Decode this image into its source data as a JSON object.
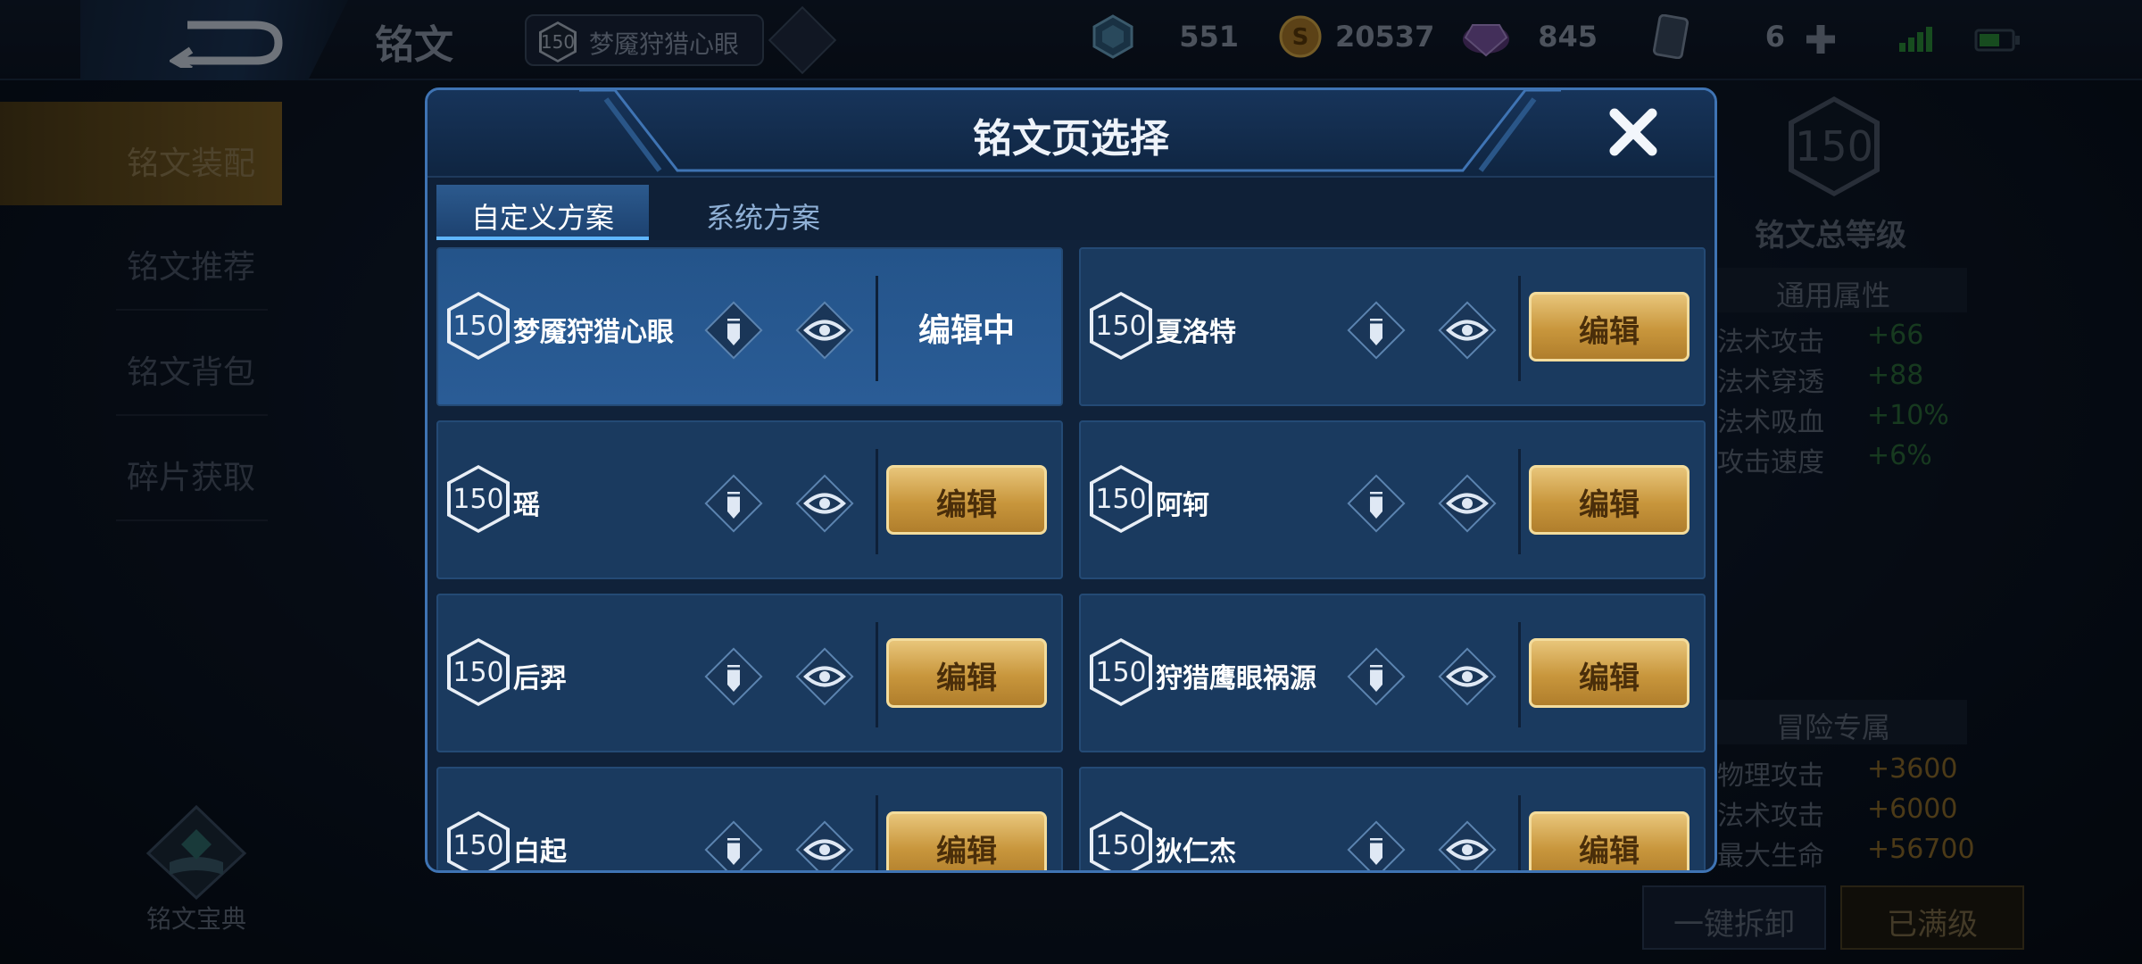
{
  "topbar": {
    "title": "铭文",
    "set_chip": {
      "level": "150",
      "name": "梦魇狩猎心眼"
    },
    "resources": [
      {
        "icon": "crystal-icon",
        "value": "551"
      },
      {
        "icon": "gold-coin-icon",
        "value": "20537"
      },
      {
        "icon": "gem-icon",
        "value": "845"
      },
      {
        "icon": "card-icon",
        "value": "6"
      }
    ]
  },
  "sidebar": {
    "items": [
      {
        "label": "铭文装配",
        "active": true
      },
      {
        "label": "铭文推荐"
      },
      {
        "label": "铭文背包"
      },
      {
        "label": "碎片获取"
      }
    ],
    "codex_label": "铭文宝典"
  },
  "right_panel": {
    "total_level": "150",
    "total_level_label": "铭文总等级",
    "general_header": "通用属性",
    "general_stats": [
      {
        "name": "法术攻击",
        "value": "+66"
      },
      {
        "name": "法术穿透",
        "value": "+88"
      },
      {
        "name": "法术吸血",
        "value": "+10%"
      },
      {
        "name": "攻击速度",
        "value": "+6%"
      }
    ],
    "adventure_header": "冒险专属",
    "adventure_stats": [
      {
        "name": "物理攻击",
        "value": "+3600"
      },
      {
        "name": "法术攻击",
        "value": "+6000"
      },
      {
        "name": "最大生命",
        "value": "+56700"
      }
    ],
    "btn_disassemble": "一键拆卸",
    "btn_maxed": "已满级"
  },
  "dialog": {
    "title": "铭文页选择",
    "tabs": [
      {
        "label": "自定义方案",
        "active": true
      },
      {
        "label": "系统方案"
      }
    ],
    "edit_label": "编辑",
    "editing_label": "编辑中",
    "pages": [
      {
        "level": "150",
        "name": "梦魇狩猎心眼",
        "editing": true
      },
      {
        "level": "150",
        "name": "夏洛特"
      },
      {
        "level": "150",
        "name": "瑶"
      },
      {
        "level": "150",
        "name": "阿轲"
      },
      {
        "level": "150",
        "name": "后羿"
      },
      {
        "level": "150",
        "name": "狩猎鹰眼祸源"
      },
      {
        "level": "150",
        "name": "白起"
      },
      {
        "level": "150",
        "name": "狄仁杰"
      }
    ]
  }
}
